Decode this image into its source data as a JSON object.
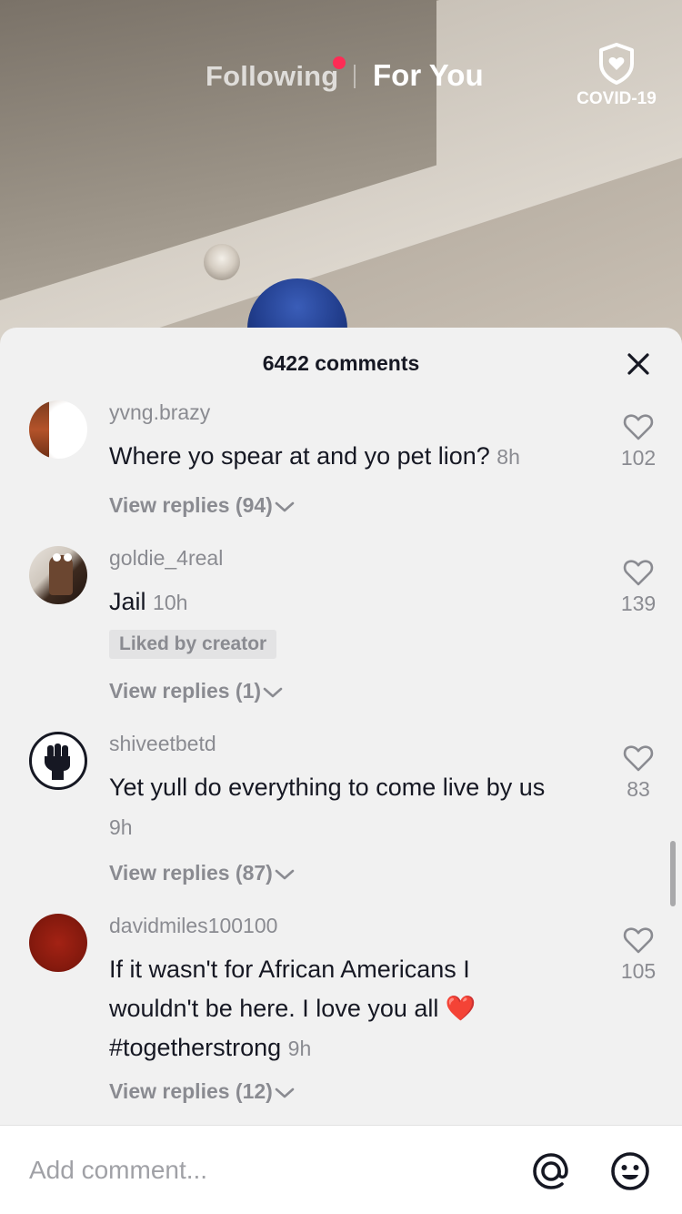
{
  "top_nav": {
    "following_label": "Following",
    "for_you_label": "For You",
    "covid_label": "COVID-19",
    "accent_dot_color": "#fe2c55"
  },
  "comments_sheet": {
    "count_label": "6422 comments",
    "close_icon": "close-icon",
    "comments": [
      {
        "username": "yvng.brazy",
        "text": "Where yo spear at and yo pet lion?",
        "time": "8h",
        "likes": "102",
        "liked_by_creator": "",
        "view_replies": "View replies (94)"
      },
      {
        "username": "goldie_4real",
        "text": "Jail",
        "time": "10h",
        "likes": "139",
        "liked_by_creator": "Liked by creator",
        "view_replies": "View replies (1)"
      },
      {
        "username": "shiveetbetd",
        "text": "Yet yull do everything to come live by us",
        "time": "9h",
        "likes": "83",
        "liked_by_creator": "",
        "view_replies": "View replies (87)"
      },
      {
        "username": "davidmiles100100",
        "text": "If it wasn't for African Americans I wouldn't be here. I love you all ❤️ #togetherstrong",
        "time": "9h",
        "likes": "105",
        "liked_by_creator": "",
        "view_replies": "View replies (12)"
      }
    ]
  },
  "composer": {
    "placeholder": "Add comment...",
    "mention_icon": "at-sign-icon",
    "emoji_icon": "smiley-icon"
  }
}
